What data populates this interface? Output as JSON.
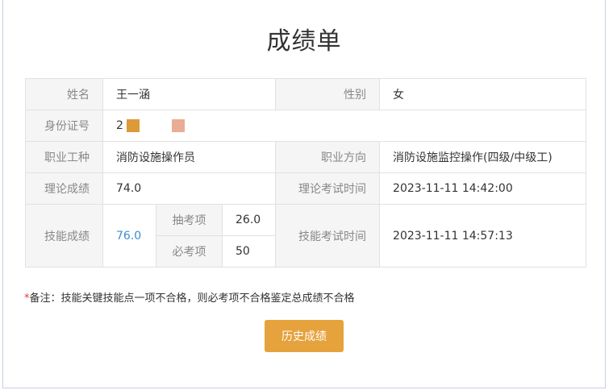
{
  "page": {
    "title": "成绩单"
  },
  "table": {
    "name_label": "姓名",
    "name_value": "王一涵",
    "gender_label": "性别",
    "gender_value": "女",
    "id_label": "身份证号",
    "id_value_visible": "2",
    "occupation_label": "职业工种",
    "occupation_value": "消防设施操作员",
    "direction_label": "职业方向",
    "direction_value": "消防设施监控操作(四级/中级工)",
    "theory_score_label": "理论成绩",
    "theory_score_value": "74.0",
    "theory_time_label": "理论考试时间",
    "theory_time_value": "2023-11-11 14:42:00",
    "skill_score_label": "技能成绩",
    "skill_score_value": "76.0",
    "random_item_label": "抽考项",
    "random_item_value": "26.0",
    "required_item_label": "必考项",
    "required_item_value": "50",
    "skill_time_label": "技能考试时间",
    "skill_time_value": "2023-11-11 14:57:13"
  },
  "note": {
    "star": "*",
    "text": "备注：技能关键技能点一项不合格，则必考项不合格鉴定总成绩不合格"
  },
  "buttons": {
    "history_label": "历史成绩"
  },
  "colors": {
    "accent_button": "#e6a23c",
    "score_link": "#3c8dd0",
    "note_star": "#e53935",
    "mask_1": "#dc9a3a",
    "mask_2": "#e9ad93"
  }
}
